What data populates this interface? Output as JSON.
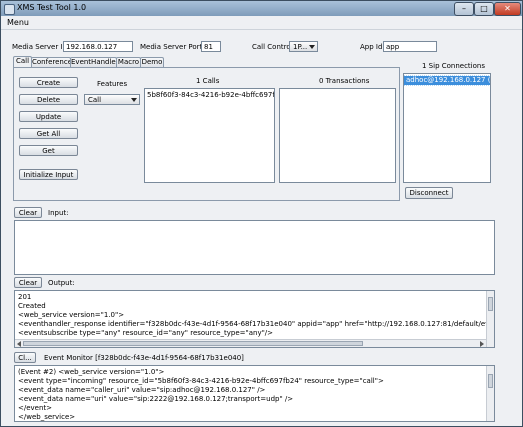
{
  "window": {
    "title": "XMS Test Tool 1.0",
    "min": "–",
    "max": "□",
    "close": "✕"
  },
  "menu": {
    "label": "Menu"
  },
  "config": {
    "media_server_ip_label": "Media Server IP",
    "media_server_ip": "192.168.0.127",
    "media_server_port_label": "Media Server Port",
    "media_server_port": "81",
    "call_control_label": "Call Control",
    "call_control": "1P...",
    "app_id_label": "App Id:",
    "app_id": "app"
  },
  "tabs": [
    "Call",
    "Conference",
    "EventHandler",
    "Macro",
    "Demo"
  ],
  "call_panel": {
    "buttons": {
      "create": "Create",
      "delete": "Delete",
      "update": "Update",
      "get_all": "Get All",
      "get": "Get",
      "initialize_input": "Initialize Input"
    },
    "features_label": "Features",
    "features_value": "Call",
    "calls_header": "1 Calls",
    "calls": [
      "5b8f60f3-84c3-4216-b92e-4bffc697fb24"
    ],
    "transactions_header": "0 Transactions"
  },
  "sip": {
    "header": "1 Sip Connections",
    "items": [
      "adhoc@192.168.0.127 (NO"
    ],
    "disconnect": "Disconnect"
  },
  "input": {
    "clear": "Clear",
    "label": "Input:"
  },
  "output": {
    "clear": "Clear",
    "label": "Output:",
    "lines": [
      "201",
      "Created",
      "<web_service version=\"1.0\">",
      "<eventhandler_response identifier=\"f328b0dc-f43e-4d1f-9564-68f17b31e040\" appid=\"app\" href=\"http://192.168.0.127:81/default/eventhan",
      "<eventsubscribe type=\"any\" resource_id=\"any\" resource_type=\"any\"/>"
    ]
  },
  "event_monitor": {
    "clear": "Cl...",
    "label": "Event Monitor [f328b0dc-f43e-4d1f-9564-68f17b31e040]",
    "lines": [
      "(Event #2) <web_service version=\"1.0\">",
      "<event type=\"incoming\" resource_id=\"5b8f60f3-84c3-4216-b92e-4bffc697fb24\" resource_type=\"call\">",
      "<event_data name=\"caller_uri\" value=\"sip:adhoc@192.168.0.127\" />",
      "<event_data name=\"uri\" value=\"sip:2222@192.168.0.127;transport=udp\" />",
      "</event>",
      "</web_service>"
    ]
  }
}
